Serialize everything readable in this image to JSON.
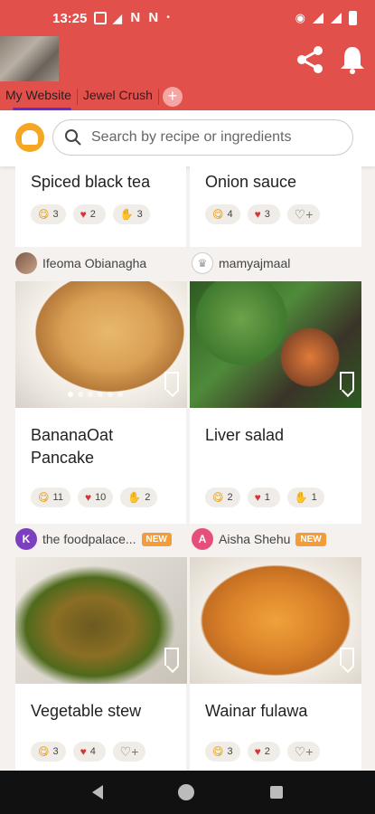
{
  "status": {
    "time": "13:25"
  },
  "header": {
    "tabs": [
      {
        "label": "My Website"
      },
      {
        "label": "Jewel Crush"
      }
    ],
    "add_tab": "+"
  },
  "search": {
    "placeholder": "Search by recipe or ingredients"
  },
  "cards": [
    {
      "title": "Spiced black tea",
      "reactions": {
        "yum": "3",
        "heart": "2",
        "clap": "3"
      }
    },
    {
      "title": "Onion sauce",
      "reactions": {
        "yum": "4",
        "heart": "3"
      }
    },
    {
      "author": "Ifeoma Obianagha",
      "title": "BananaOat Pancake",
      "reactions": {
        "yum": "11",
        "heart": "10",
        "clap": "2"
      }
    },
    {
      "author": "mamyajmaal",
      "title": "Liver salad",
      "reactions": {
        "yum": "2",
        "heart": "1",
        "clap": "1"
      }
    },
    {
      "author": "the foodpalace...",
      "author_initial": "K",
      "badge": "NEW",
      "title": "Vegetable stew",
      "reactions": {
        "yum": "3",
        "heart": "4"
      }
    },
    {
      "author": "Aisha Shehu",
      "author_initial": "A",
      "badge": "NEW",
      "title": "Wainar fulawa",
      "reactions": {
        "yum": "3",
        "heart": "2"
      }
    }
  ],
  "colors": {
    "brand": "#e2504c",
    "accent": "#6b2bd0",
    "new_badge": "#f39c3a"
  }
}
